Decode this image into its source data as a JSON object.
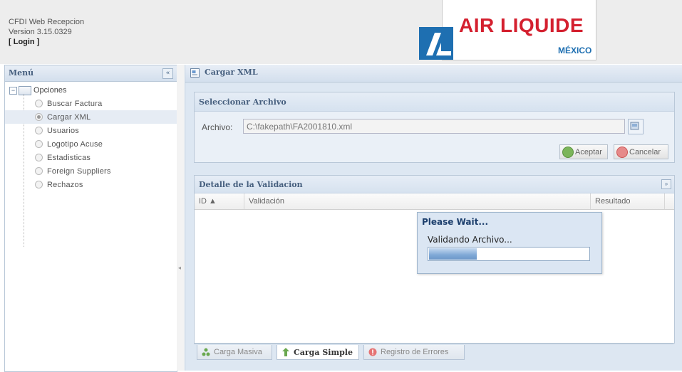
{
  "header": {
    "app_name": "CFDI Web Recepcion",
    "version": "Version 3.15.0329",
    "login": "[ Login ]",
    "logo_text": "AIR LIQUIDE",
    "logo_sub": "MÉXICO",
    "brand_red": "#d4202f",
    "brand_blue": "#1e6fb1"
  },
  "menu": {
    "title": "Menú",
    "root": "Opciones",
    "items": [
      {
        "label": "Buscar Factura",
        "selected": false
      },
      {
        "label": "Cargar XML",
        "selected": true
      },
      {
        "label": "Usuarios",
        "selected": false
      },
      {
        "label": "Logotipo Acuse",
        "selected": false
      },
      {
        "label": "Estadisticas",
        "selected": false
      },
      {
        "label": "Foreign Suppliers",
        "selected": false
      },
      {
        "label": "Rechazos",
        "selected": false
      }
    ]
  },
  "main": {
    "title": "Cargar XML",
    "select_panel": {
      "title": "Seleccionar Archivo",
      "file_label": "Archivo:",
      "file_value": "C:\\fakepath\\FA2001810.xml",
      "accept_label": "Aceptar",
      "cancel_label": "Cancelar"
    },
    "detail_panel": {
      "title": "Detalle de la Validacion",
      "columns": [
        "ID ▲",
        "Validación",
        "Resultado"
      ]
    },
    "tabs": [
      {
        "label": "Carga Masiva",
        "active": false
      },
      {
        "label": "Carga Simple",
        "active": true
      },
      {
        "label": "Registro de Errores",
        "active": false
      }
    ]
  },
  "wait_dialog": {
    "title": "Please Wait...",
    "message": "Validando Archivo...",
    "progress": 0.3
  }
}
